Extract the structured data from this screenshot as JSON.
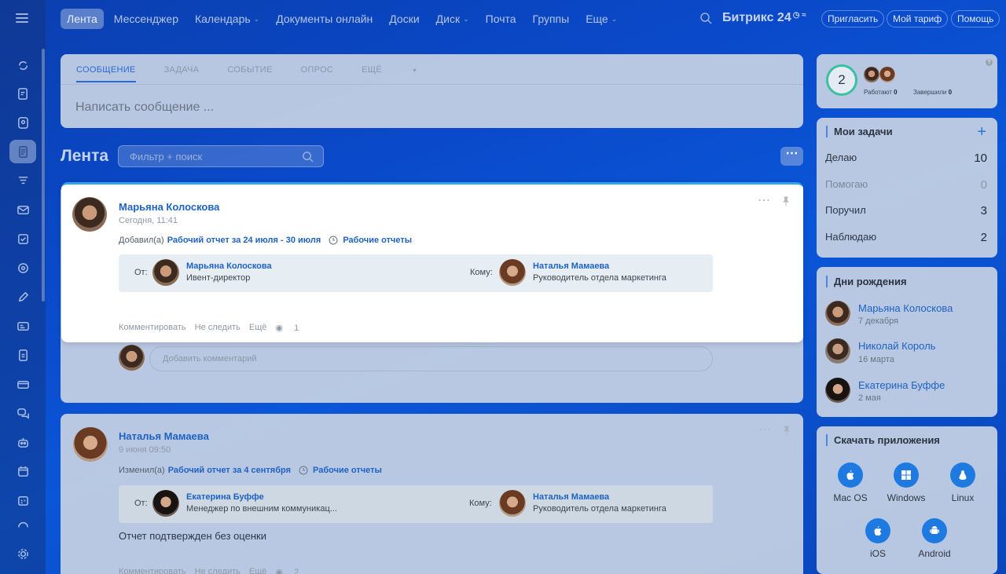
{
  "nav": {
    "items": [
      {
        "label": "Лента",
        "active": true
      },
      {
        "label": "Мессенджер"
      },
      {
        "label": "Календарь",
        "dropdown": true
      },
      {
        "label": "Документы онлайн"
      },
      {
        "label": "Доски"
      },
      {
        "label": "Диск",
        "dropdown": true
      },
      {
        "label": "Почта"
      },
      {
        "label": "Группы"
      },
      {
        "label": "Еще",
        "dropdown": true
      }
    ],
    "logo": "Битрикс 24",
    "invite": "Пригласить",
    "tariff": "Мой тариф",
    "help": "Помощь"
  },
  "composer": {
    "tabs": [
      "СООБЩЕНИЕ",
      "ЗАДАЧА",
      "СОБЫТИЕ",
      "ОПРОС",
      "ЕЩЁ"
    ],
    "placeholder": "Написать сообщение ..."
  },
  "feed": {
    "title": "Лента",
    "filter_placeholder": "Фильтр + поиск"
  },
  "post1": {
    "author": "Марьяна Колоскова",
    "date": "Сегодня, 11:41",
    "action": "Добавил(а)",
    "link": "Рабочий отчет за 24 июля - 30 июля",
    "category": "Рабочие отчеты",
    "from_label": "От:",
    "from_name": "Марьяна Колоскова",
    "from_role": "Ивент-директор",
    "to_label": "Кому:",
    "to_name": "Наталья Мамаева",
    "to_role": "Руководитель отдела маркетинга",
    "comment": "Комментировать",
    "unfollow": "Не следить",
    "more": "Ещё",
    "views": "1",
    "comment_placeholder": "Добавить комментарий"
  },
  "post2": {
    "author": "Наталья Мамаева",
    "date": "9 июня 09:50",
    "action": "Изменил(а)",
    "link": "Рабочий отчет за 4 сентября",
    "category": "Рабочие отчеты",
    "from_label": "От:",
    "from_name": "Екатерина Буффе",
    "from_role": "Менеджер по внешним коммуникац...",
    "to_label": "Кому:",
    "to_name": "Наталья Мамаева",
    "to_role": "Руководитель отдела маркетинга",
    "body": "Отчет подтвержден без оценки",
    "comment": "Комментировать",
    "unfollow": "Не следить",
    "more": "Ещё",
    "views": "2"
  },
  "employees": {
    "count": "2",
    "working_label": "Работают",
    "working": "0",
    "done_label": "Завершили",
    "done": "0"
  },
  "tasks": {
    "title": "Мои задачи",
    "rows": [
      {
        "label": "Делаю",
        "value": "10"
      },
      {
        "label": "Помогаю",
        "value": "0"
      },
      {
        "label": "Поручил",
        "value": "3"
      },
      {
        "label": "Наблюдаю",
        "value": "2"
      }
    ]
  },
  "birthdays": {
    "title": "Дни рождения",
    "people": [
      {
        "name": "Марьяна Колоскова",
        "date": "7 декабря"
      },
      {
        "name": "Николай Король",
        "date": "16 марта"
      },
      {
        "name": "Екатерина Буффе",
        "date": "2 мая"
      }
    ]
  },
  "apps": {
    "title": "Скачать приложения",
    "items": [
      {
        "label": "Mac OS",
        "icon": "apple-icon"
      },
      {
        "label": "Windows",
        "icon": "windows-icon"
      },
      {
        "label": "Linux",
        "icon": "linux-icon"
      },
      {
        "label": "iOS",
        "icon": "apple-icon"
      },
      {
        "label": "Android",
        "icon": "android-icon"
      }
    ]
  },
  "colors": {
    "accent": "#1e62c2",
    "ring": "#3bc0a2",
    "app_icon": "#1e7ae0"
  }
}
